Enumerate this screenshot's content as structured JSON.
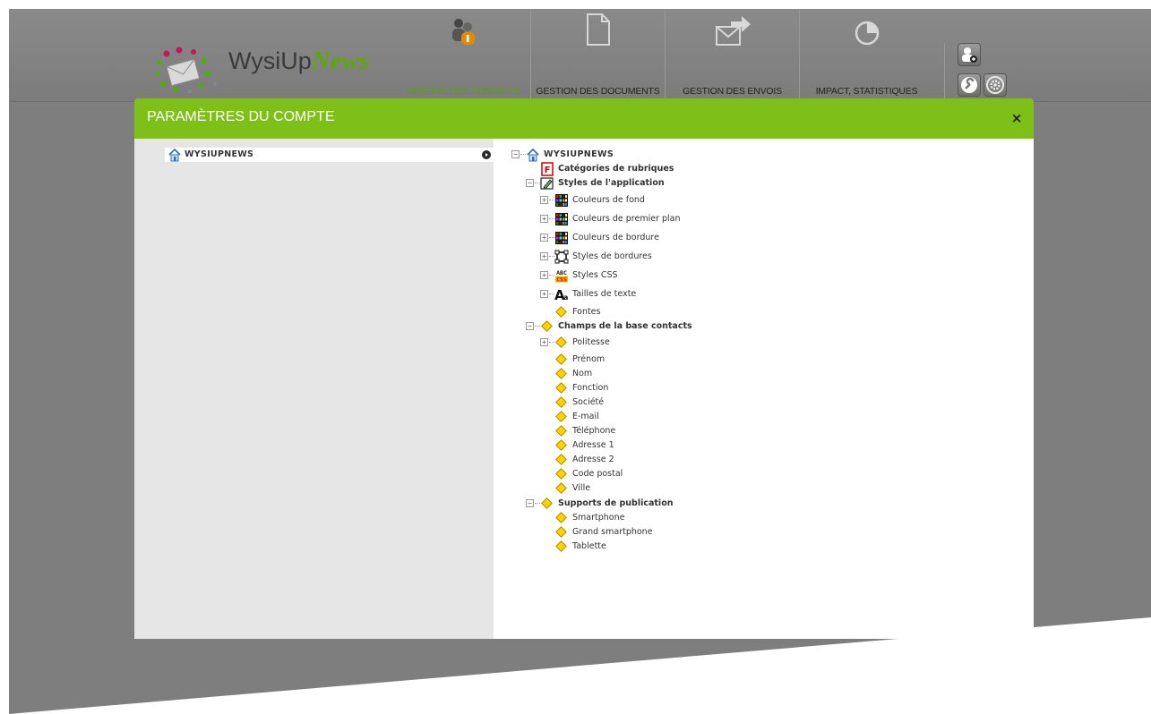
{
  "app": {
    "logo_prefix": "WysiUp",
    "logo_accent": "News"
  },
  "nav": {
    "tabs": [
      {
        "label": "GESTION DES CONTACTS",
        "icon": "contacts-icon",
        "active": true
      },
      {
        "label": "GESTION DES DOCUMENTS",
        "icon": "document-icon",
        "active": false
      },
      {
        "label": "GESTION DES ENVOIS",
        "icon": "send-icon",
        "active": false
      },
      {
        "label": "IMPACT, STATISTIQUES",
        "icon": "pie-chart-icon",
        "active": false
      }
    ]
  },
  "tools": [
    "add-user-icon",
    "wrench-icon",
    "gear-icon"
  ],
  "modal": {
    "title": "PARAMÈTRES DU COMPTE",
    "close": "×",
    "accent_color": "#7ec019"
  },
  "left_panel": {
    "items": [
      {
        "label": "WYSIUPNEWS",
        "icon": "home-icon"
      }
    ]
  },
  "tree": {
    "root": "WYSIUPNEWS",
    "categories": "Catégories de rubriques",
    "styles": {
      "label": "Styles de l'application",
      "children": [
        "Couleurs de fond",
        "Couleurs de premier plan",
        "Couleurs de bordure",
        "Styles de bordures",
        "Styles CSS",
        "Tailles de texte",
        "Fontes"
      ]
    },
    "champs": {
      "label": "Champs de la base contacts",
      "children": [
        "Politesse",
        "Prénom",
        "Nom",
        "Fonction",
        "Société",
        "E-mail",
        "Téléphone",
        "Adresse 1",
        "Adresse 2",
        "Code postal",
        "Ville"
      ]
    },
    "supports": {
      "label": "Supports de publication",
      "children": [
        "Smartphone",
        "Grand smartphone",
        "Tablette"
      ]
    }
  }
}
